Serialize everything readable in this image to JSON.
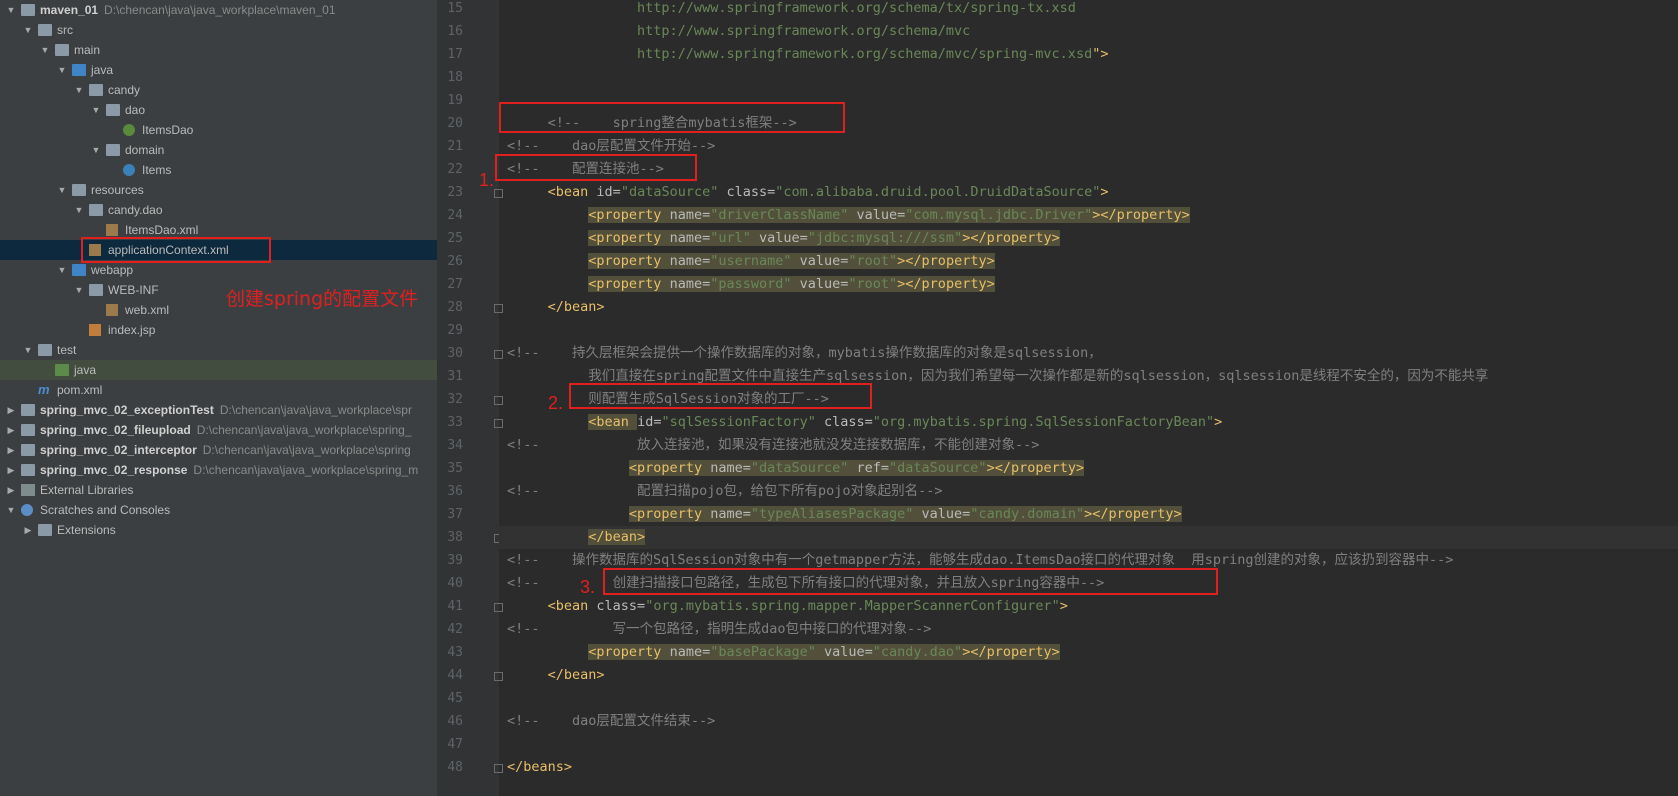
{
  "project_tree": [
    {
      "label": "maven_01",
      "path": "D:\\chencan\\java\\java_workplace\\maven_01",
      "bold": true,
      "indent": 0,
      "arrow": "down",
      "icon": "module-folder"
    },
    {
      "label": "src",
      "indent": 1,
      "arrow": "down",
      "icon": "folder"
    },
    {
      "label": "main",
      "indent": 2,
      "arrow": "down",
      "icon": "folder"
    },
    {
      "label": "java",
      "indent": 3,
      "arrow": "down",
      "icon": "source-folder"
    },
    {
      "label": "candy",
      "indent": 4,
      "arrow": "down",
      "icon": "package"
    },
    {
      "label": "dao",
      "indent": 5,
      "arrow": "down",
      "icon": "package"
    },
    {
      "label": "ItemsDao",
      "indent": 6,
      "arrow": "",
      "icon": "interface"
    },
    {
      "label": "domain",
      "indent": 5,
      "arrow": "down",
      "icon": "package"
    },
    {
      "label": "Items",
      "indent": 6,
      "arrow": "",
      "icon": "class"
    },
    {
      "label": "resources",
      "indent": 3,
      "arrow": "down",
      "icon": "resources-folder"
    },
    {
      "label": "candy.dao",
      "indent": 4,
      "arrow": "down",
      "icon": "folder"
    },
    {
      "label": "ItemsDao.xml",
      "indent": 5,
      "arrow": "",
      "icon": "xml-file"
    },
    {
      "label": "applicationContext.xml",
      "indent": 4,
      "arrow": "",
      "icon": "xml-file",
      "selected": true
    },
    {
      "label": "webapp",
      "indent": 3,
      "arrow": "down",
      "icon": "web-folder"
    },
    {
      "label": "WEB-INF",
      "indent": 4,
      "arrow": "down",
      "icon": "folder"
    },
    {
      "label": "web.xml",
      "indent": 5,
      "arrow": "",
      "icon": "xml-file"
    },
    {
      "label": "index.jsp",
      "indent": 4,
      "arrow": "",
      "icon": "jsp-file"
    },
    {
      "label": "test",
      "indent": 1,
      "arrow": "down",
      "icon": "folder"
    },
    {
      "label": "java",
      "indent": 2,
      "arrow": "",
      "icon": "test-folder",
      "selected2": true
    },
    {
      "label": "pom.xml",
      "indent": 1,
      "arrow": "",
      "icon": "maven-file"
    },
    {
      "label": "spring_mvc_02_exceptionTest",
      "path": "D:\\chencan\\java\\java_workplace\\spr",
      "bold": true,
      "indent": 0,
      "arrow": "right",
      "icon": "module-folder"
    },
    {
      "label": "spring_mvc_02_fileupload",
      "path": "D:\\chencan\\java\\java_workplace\\spring_",
      "bold": true,
      "indent": 0,
      "arrow": "right",
      "icon": "module-folder"
    },
    {
      "label": "spring_mvc_02_interceptor",
      "path": "D:\\chencan\\java\\java_workplace\\spring",
      "bold": true,
      "indent": 0,
      "arrow": "right",
      "icon": "module-folder"
    },
    {
      "label": "spring_mvc_02_response",
      "path": "D:\\chencan\\java\\java_workplace\\spring_m",
      "bold": true,
      "indent": 0,
      "arrow": "right",
      "icon": "module-folder"
    },
    {
      "label": "External Libraries",
      "indent": 0,
      "arrow": "right",
      "icon": "libraries"
    },
    {
      "label": "Scratches and Consoles",
      "indent": 0,
      "arrow": "down",
      "icon": "scratches"
    },
    {
      "label": "Extensions",
      "indent": 1,
      "arrow": "right",
      "icon": "folder"
    }
  ],
  "annotation_create": "创建spring的配置文件",
  "code_lines": [
    {
      "n": "15",
      "tokens": [
        [
          "v",
          "                http://www.springframework.org/schema/tx/spring-tx.xsd"
        ]
      ]
    },
    {
      "n": "16",
      "tokens": [
        [
          "v",
          "                http://www.springframework.org/schema/mvc"
        ]
      ]
    },
    {
      "n": "17",
      "tokens": [
        [
          "v",
          "                http://www.springframework.org/schema/mvc/spring-mvc.xsd"
        ],
        [
          "t",
          "\">"
        ]
      ]
    },
    {
      "n": "18",
      "tokens": []
    },
    {
      "n": "19",
      "tokens": []
    },
    {
      "n": "20",
      "tokens": [
        [
          "c",
          "     <!--    spring整合mybatis框架-->"
        ]
      ]
    },
    {
      "n": "21",
      "tokens": [
        [
          "c",
          "<!--    dao层配置文件开始-->"
        ]
      ]
    },
    {
      "n": "22",
      "tokens": [
        [
          "c",
          "<!--    配置连接池-->"
        ]
      ]
    },
    {
      "n": "23",
      "tokens": [
        [
          "p",
          "     "
        ],
        [
          "t",
          "<bean "
        ],
        [
          "a",
          "id="
        ],
        [
          "s",
          "\"dataSource\" "
        ],
        [
          "a",
          "class="
        ],
        [
          "s",
          "\"com.alibaba.druid.pool.DruidDataSource\""
        ],
        [
          "t",
          ">"
        ]
      ]
    },
    {
      "n": "24",
      "tokens": [
        [
          "p",
          "          "
        ],
        [
          "th",
          "<property "
        ],
        [
          "ah",
          "name="
        ],
        [
          "sh",
          "\"driverClassName\" "
        ],
        [
          "ah",
          "value="
        ],
        [
          "sh",
          "\"com.mysql.jdbc.Driver\""
        ],
        [
          "th",
          "></property>"
        ]
      ]
    },
    {
      "n": "25",
      "tokens": [
        [
          "p",
          "          "
        ],
        [
          "th",
          "<property "
        ],
        [
          "ah",
          "name="
        ],
        [
          "sh",
          "\"url\" "
        ],
        [
          "ah",
          "value="
        ],
        [
          "sh",
          "\"jdbc:mysql:///ssm\""
        ],
        [
          "th",
          "></property>"
        ]
      ]
    },
    {
      "n": "26",
      "tokens": [
        [
          "p",
          "          "
        ],
        [
          "th",
          "<property "
        ],
        [
          "ah",
          "name="
        ],
        [
          "sh",
          "\"username\" "
        ],
        [
          "ah",
          "value="
        ],
        [
          "sh",
          "\"root\""
        ],
        [
          "th",
          "></property>"
        ]
      ]
    },
    {
      "n": "27",
      "tokens": [
        [
          "p",
          "          "
        ],
        [
          "th",
          "<property "
        ],
        [
          "ah",
          "name="
        ],
        [
          "sh",
          "\"password\" "
        ],
        [
          "ah",
          "value="
        ],
        [
          "sh",
          "\"root\""
        ],
        [
          "th",
          "></property>"
        ]
      ]
    },
    {
      "n": "28",
      "tokens": [
        [
          "p",
          "     "
        ],
        [
          "t",
          "</bean>"
        ]
      ]
    },
    {
      "n": "29",
      "tokens": []
    },
    {
      "n": "30",
      "tokens": [
        [
          "c",
          "<!--    持久层框架会提供一个操作数据库的对象，mybatis操作数据库的对象是sqlsession，"
        ]
      ]
    },
    {
      "n": "31",
      "tokens": [
        [
          "c",
          "          我们直接在spring配置文件中直接生产sqlsession，因为我们希望每一次操作都是新的sqlsession，sqlsession是线程不安全的，因为不能共享"
        ]
      ]
    },
    {
      "n": "32",
      "tokens": [
        [
          "c",
          "          则配置生成SqlSession对象的工厂-->"
        ]
      ]
    },
    {
      "n": "33",
      "tokens": [
        [
          "p",
          "          "
        ],
        [
          "th",
          "<bean "
        ],
        [
          "a",
          "id="
        ],
        [
          "s",
          "\"sqlSessionFactory\" "
        ],
        [
          "a",
          "class="
        ],
        [
          "s",
          "\"org.mybatis.spring.SqlSessionFactoryBean\""
        ],
        [
          "t",
          ">"
        ]
      ]
    },
    {
      "n": "34",
      "tokens": [
        [
          "c",
          "<!--            放入连接池，如果没有连接池就没发连接数据库，不能创建对象-->"
        ]
      ]
    },
    {
      "n": "35",
      "tokens": [
        [
          "p",
          "               "
        ],
        [
          "th",
          "<property "
        ],
        [
          "ah",
          "name="
        ],
        [
          "sh",
          "\"dataSource\" "
        ],
        [
          "ah",
          "ref="
        ],
        [
          "sh",
          "\"dataSource\""
        ],
        [
          "th",
          "></property>"
        ]
      ]
    },
    {
      "n": "36",
      "tokens": [
        [
          "c",
          "<!--            配置扫描pojo包，给包下所有pojo对象起别名-->"
        ]
      ]
    },
    {
      "n": "37",
      "tokens": [
        [
          "p",
          "               "
        ],
        [
          "th",
          "<property "
        ],
        [
          "ah",
          "name="
        ],
        [
          "sh",
          "\"typeAliasesPackage\" "
        ],
        [
          "ah",
          "value="
        ],
        [
          "sh",
          "\"candy.domain\""
        ],
        [
          "th",
          "></property>"
        ]
      ]
    },
    {
      "n": "38",
      "tokens": [
        [
          "p",
          "          "
        ],
        [
          "th",
          "</bean>"
        ]
      ]
    },
    {
      "n": "39",
      "tokens": [
        [
          "c",
          "<!--    操作数据库的SqlSession对象中有一个getmapper方法，能够生成dao.ItemsDao接口的代理对象  用spring创建的对象，应该扔到容器中-->"
        ]
      ]
    },
    {
      "n": "40",
      "tokens": [
        [
          "c",
          "<!--         创建扫描接口包路径，生成包下所有接口的代理对象，并且放入spring容器中-->"
        ]
      ]
    },
    {
      "n": "41",
      "tokens": [
        [
          "p",
          "     "
        ],
        [
          "t",
          "<bean "
        ],
        [
          "a",
          "class="
        ],
        [
          "s",
          "\"org.mybatis.spring.mapper.MapperScannerConfigurer\""
        ],
        [
          "t",
          ">"
        ]
      ]
    },
    {
      "n": "42",
      "tokens": [
        [
          "c",
          "<!--         写一个包路径，指明生成dao包中接口的代理对象-->"
        ]
      ]
    },
    {
      "n": "43",
      "tokens": [
        [
          "p",
          "          "
        ],
        [
          "th",
          "<property "
        ],
        [
          "ah",
          "name="
        ],
        [
          "sh",
          "\"basePackage\" "
        ],
        [
          "ah",
          "value="
        ],
        [
          "sh",
          "\"candy.dao\""
        ],
        [
          "th",
          "></property>"
        ]
      ]
    },
    {
      "n": "44",
      "tokens": [
        [
          "p",
          "     "
        ],
        [
          "t",
          "</bean>"
        ]
      ]
    },
    {
      "n": "45",
      "tokens": []
    },
    {
      "n": "46",
      "tokens": [
        [
          "c",
          "<!--    dao层配置文件结束-->"
        ]
      ]
    },
    {
      "n": "47",
      "tokens": []
    },
    {
      "n": "48",
      "tokens": [
        [
          "t",
          "</beans>"
        ]
      ]
    }
  ],
  "markers": {
    "m1": "1.",
    "m2": "2.",
    "m3": "3."
  },
  "colors": {
    "annotation_red": "#e0201f",
    "tag": "#e8bf6a",
    "string": "#6a8759",
    "comment": "#808080"
  }
}
